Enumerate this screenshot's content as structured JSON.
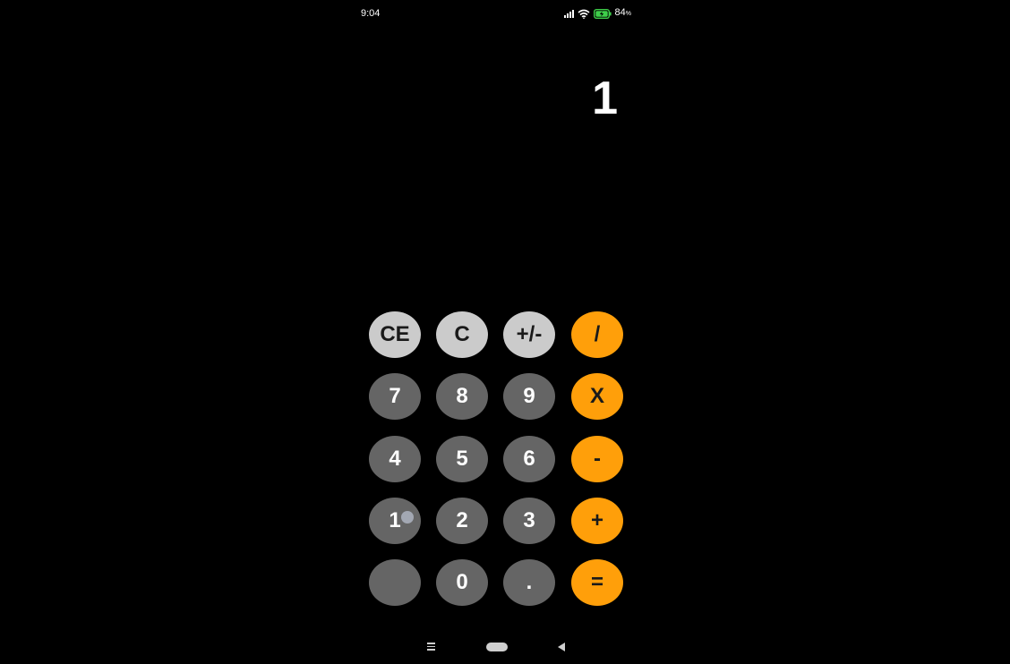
{
  "status_bar": {
    "time": "9:04",
    "battery_percent": "84",
    "battery_unit": "%",
    "icons": [
      "signal-icon",
      "wifi-icon",
      "battery-charging-icon"
    ]
  },
  "display": {
    "value": "1"
  },
  "keypad": {
    "rows": [
      [
        {
          "label": "CE",
          "style": "light"
        },
        {
          "label": "C",
          "style": "light"
        },
        {
          "label": "+/-",
          "style": "light"
        },
        {
          "label": "/",
          "style": "op"
        }
      ],
      [
        {
          "label": "7",
          "style": "dark"
        },
        {
          "label": "8",
          "style": "dark"
        },
        {
          "label": "9",
          "style": "dark"
        },
        {
          "label": "X",
          "style": "op"
        }
      ],
      [
        {
          "label": "4",
          "style": "dark"
        },
        {
          "label": "5",
          "style": "dark"
        },
        {
          "label": "6",
          "style": "dark"
        },
        {
          "label": "-",
          "style": "op"
        }
      ],
      [
        {
          "label": "1",
          "style": "dark"
        },
        {
          "label": "2",
          "style": "dark"
        },
        {
          "label": "3",
          "style": "dark"
        },
        {
          "label": "+",
          "style": "op"
        }
      ],
      [
        {
          "label": "",
          "style": "dark"
        },
        {
          "label": "0",
          "style": "dark"
        },
        {
          "label": ".",
          "style": "dark"
        },
        {
          "label": "=",
          "style": "op"
        }
      ]
    ]
  },
  "colors": {
    "background": "#000000",
    "light_key": "#cbcbcb",
    "dark_key": "#656565",
    "operator_key": "#ff9f0a",
    "text": "#ffffff"
  },
  "nav_bar": {
    "icons": [
      "menu-icon",
      "home-icon",
      "back-icon"
    ]
  }
}
